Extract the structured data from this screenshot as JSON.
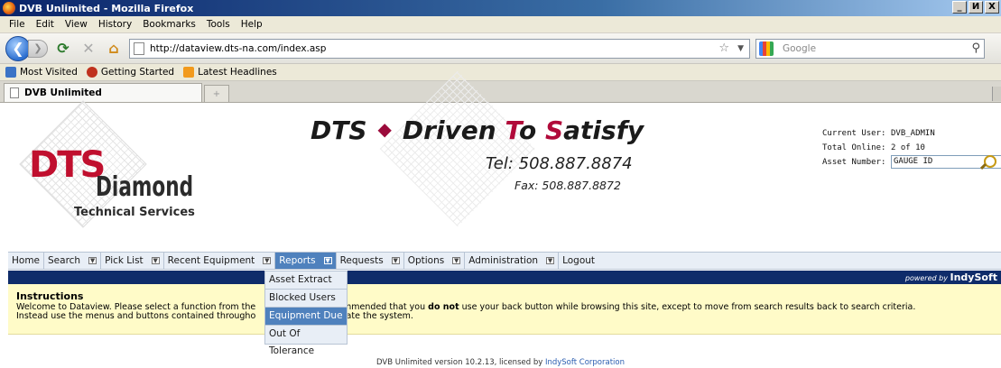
{
  "browser": {
    "window_title": "DVB Unlimited - Mozilla Firefox",
    "window_buttons": [
      "_",
      "И",
      "X"
    ],
    "menus": [
      "File",
      "Edit",
      "View",
      "History",
      "Bookmarks",
      "Tools",
      "Help"
    ],
    "url": "http://dataview.dts-na.com/index.asp",
    "search_placeholder": "Google",
    "bookmarks": [
      "Most Visited",
      "Getting Started",
      "Latest Headlines"
    ],
    "tab_title": "DVB Unlimited"
  },
  "header": {
    "logo_letters": "DTS",
    "logo_name": "Diamond",
    "logo_sub": "Technical Services",
    "tag_dts": "DTS",
    "tag_diamond": "◆",
    "tag_driven": "Driven",
    "tag_to_prefix": "T",
    "tag_to_suffix": "o",
    "tag_satisfy_prefix": "S",
    "tag_satisfy_suffix": "atisfy",
    "tel": "Tel: 508.887.8874",
    "fax": "Fax: 508.887.8872",
    "current_user_label": "Current User:",
    "current_user": "DVB_ADMIN",
    "total_online_label": "Total Online:",
    "total_online": "2 of 10",
    "asset_number_label": "Asset Number:",
    "asset_number_value": "GAUGE ID"
  },
  "appnav": {
    "items": [
      {
        "label": "Home",
        "dropdown": false
      },
      {
        "label": "Search",
        "dropdown": true
      },
      {
        "label": "Pick List",
        "dropdown": true
      },
      {
        "label": "Recent Equipment",
        "dropdown": true
      },
      {
        "label": "Reports",
        "dropdown": true
      },
      {
        "label": "Requests",
        "dropdown": true
      },
      {
        "label": "Options",
        "dropdown": true
      },
      {
        "label": "Administration",
        "dropdown": true
      },
      {
        "label": "Logout",
        "dropdown": false
      }
    ],
    "reports_menu": [
      "Asset Extract",
      "Blocked Users",
      "Equipment Due",
      "Out Of Tolerance"
    ],
    "powered_by": "powered by",
    "powered_brand": "IndySoft"
  },
  "instructions": {
    "title": "Instructions",
    "line1_a": "Welcome to Dataview. Please select a function from the",
    "line1_b": "p. It is recommended that you ",
    "line1_bold": "do not",
    "line1_c": " use your back button while browsing this site, except to move from search results back to search criteria.",
    "line2_a": "Instead use the menus and buttons contained througho",
    "line2_b": "vigate the system."
  },
  "footer": {
    "text": "DVB Unlimited version 10.2.13, licensed by ",
    "link": "IndySoft Corporation"
  },
  "colors": {
    "nav_active": "#4f81bd",
    "bluebar": "#0f2c6a",
    "instructions_bg": "#fffbc8",
    "brand_red": "#b10a3a"
  }
}
